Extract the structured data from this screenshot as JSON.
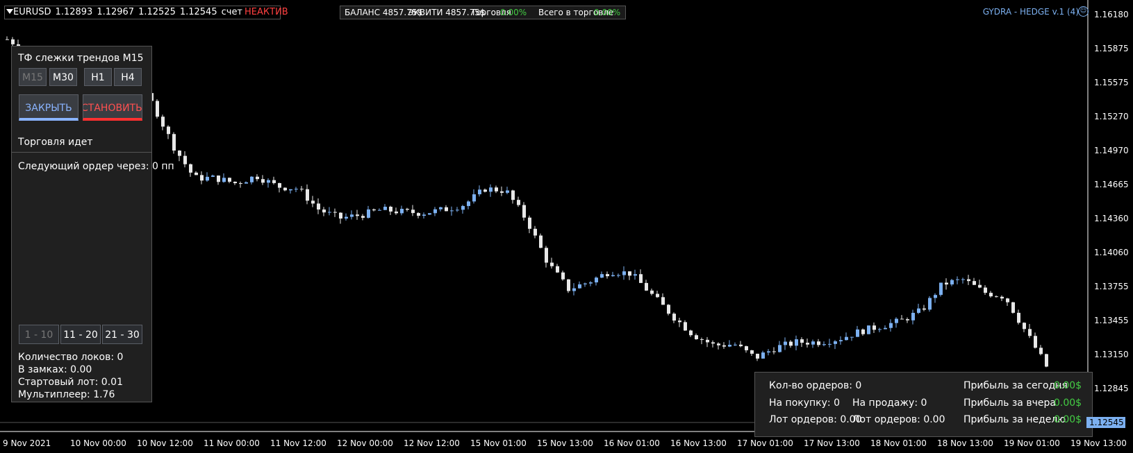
{
  "symbol_bar": {
    "symbol": "EURUSD",
    "quotes": [
      "1.12893",
      "1.12967",
      "1.12525",
      "1.12545"
    ],
    "account_label": "счет",
    "account_status": "НЕАКТИВ"
  },
  "balance_bar": {
    "balance": "БАЛАНС 4857.75$",
    "equity": "ЭКВИТИ 4857.75$",
    "trading_label": "Торговля",
    "trading_value": "0.00%",
    "total_label": "Всего в торговле",
    "total_value": "0.00%"
  },
  "ea_title": "GYDRA - HEDGE v.1 (4)",
  "left_panel": {
    "tf_title": "ТФ слежки трендов M15",
    "tf_buttons": [
      "M15",
      "M30",
      "H1",
      "H4"
    ],
    "close_button": "ЗАКРЫТЬ",
    "stop_button": "ОСТАНОВИТЬ",
    "status": "Торговля идет",
    "next_order": "Следующий ордер через: 0 пп",
    "pages": [
      "1 - 10",
      "11 - 20",
      "21 - 30"
    ],
    "locks_count": "Количество локов: 0",
    "in_locks": "В замках: 0.00",
    "start_lot": "Стартовый лот: 0.01",
    "multiplier": "Мультиплеер: 1.76"
  },
  "right_panel": {
    "orders_count": "Кол-во ордеров: 0",
    "buy": "На покупку: 0",
    "sell": "На продажу: 0",
    "lot_orders_buy": "Лот ордеров: 0.00",
    "lot_orders_sell": "Лот ордеров: 0.00",
    "profit_today_label": "Прибыль за сегодня",
    "profit_today": "0.00$",
    "profit_yesterday_label": "Прибыль за вчера",
    "profit_yesterday": "0.00$",
    "profit_week_label": "Прибыль за неделю",
    "profit_week": "0.00$"
  },
  "price_axis": [
    "1.16180",
    "1.15875",
    "1.15575",
    "1.15270",
    "1.14970",
    "1.14665",
    "1.14360",
    "1.14060",
    "1.13755",
    "1.13455",
    "1.13150",
    "1.12845"
  ],
  "current_price": "1.12545",
  "time_axis": [
    "9 Nov 2021",
    "10 Nov 00:00",
    "10 Nov 12:00",
    "11 Nov 00:00",
    "11 Nov 12:00",
    "12 Nov 00:00",
    "12 Nov 12:00",
    "15 Nov 01:00",
    "15 Nov 13:00",
    "16 Nov 01:00",
    "16 Nov 13:00",
    "17 Nov 01:00",
    "17 Nov 13:00",
    "18 Nov 01:00",
    "18 Nov 13:00",
    "19 Nov 01:00",
    "19 Nov 13:00"
  ],
  "colors": {
    "bull": "#7cb0f0",
    "bear": "#e8e8e8",
    "accent_red": "#ff4040",
    "accent_green": "#44cc44"
  },
  "chart_data": {
    "type": "candlestick",
    "ylim": [
      1.1245,
      1.1625
    ],
    "close_path": [
      1.1601,
      1.159,
      1.1588,
      1.1585,
      1.158,
      1.1575,
      1.1562,
      1.154,
      1.15,
      1.147,
      1.147,
      1.1465,
      1.1472,
      1.1462,
      1.146,
      1.144,
      1.1432,
      1.1435,
      1.144,
      1.1438,
      1.1437,
      1.144,
      1.1445,
      1.146,
      1.1458,
      1.143,
      1.139,
      1.1365,
      1.1372,
      1.1382,
      1.138,
      1.136,
      1.134,
      1.1322,
      1.1312,
      1.1313,
      1.13,
      1.131,
      1.1315,
      1.1315,
      1.1318,
      1.1325,
      1.133,
      1.1335,
      1.1345,
      1.137,
      1.1374,
      1.1362,
      1.1358,
      1.1325,
      1.1292
    ]
  }
}
